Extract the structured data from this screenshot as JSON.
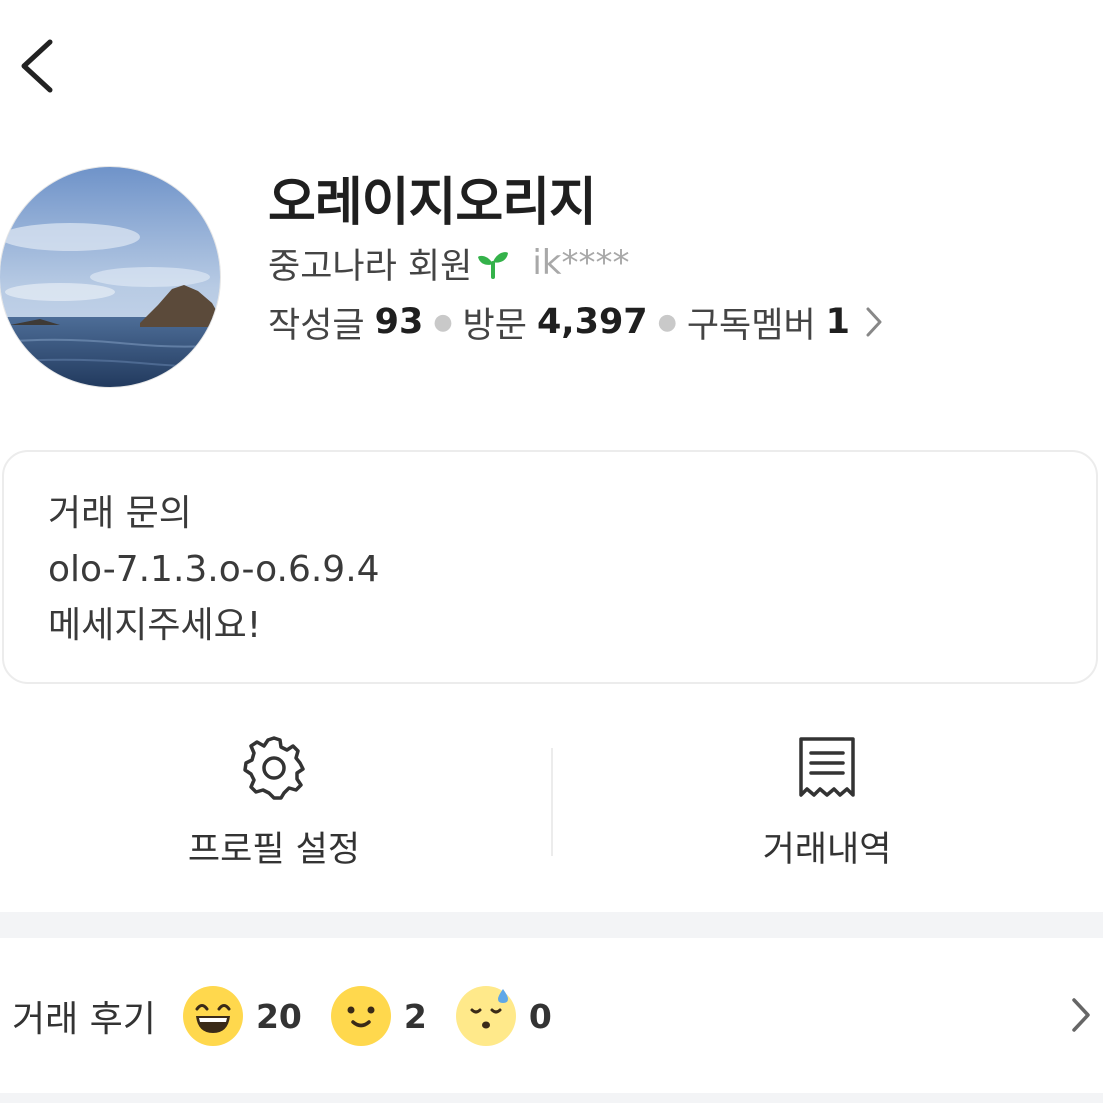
{
  "nav": {
    "back_icon": "chevron-left-icon"
  },
  "profile": {
    "nickname": "오레이지오리지",
    "member_label": "중고나라 회원",
    "member_badge_icon": "sprout-icon",
    "user_id": "ik****",
    "stats": [
      {
        "label": "작성글",
        "value": "93"
      },
      {
        "label": "방문",
        "value": "4,397"
      },
      {
        "label": "구독멤버",
        "value": "1"
      }
    ]
  },
  "intro": {
    "lines": [
      "거래 문의",
      "olo-7.1.3.o-o.6.9.4",
      "메세지주세요!"
    ]
  },
  "actions": {
    "profile_settings": {
      "label": "프로필 설정",
      "icon": "gear-icon"
    },
    "transaction_history": {
      "label": "거래내역",
      "icon": "receipt-icon"
    }
  },
  "reviews": {
    "title": "거래 후기",
    "items": [
      {
        "icon": "grinning-face-icon",
        "count": "20"
      },
      {
        "icon": "smiling-face-icon",
        "count": "2"
      },
      {
        "icon": "sweating-face-icon",
        "count": "0"
      }
    ]
  },
  "colors": {
    "accent_green": "#34b24a",
    "emoji_yellow": "#ffd84d",
    "muted": "#a8a8a8"
  }
}
